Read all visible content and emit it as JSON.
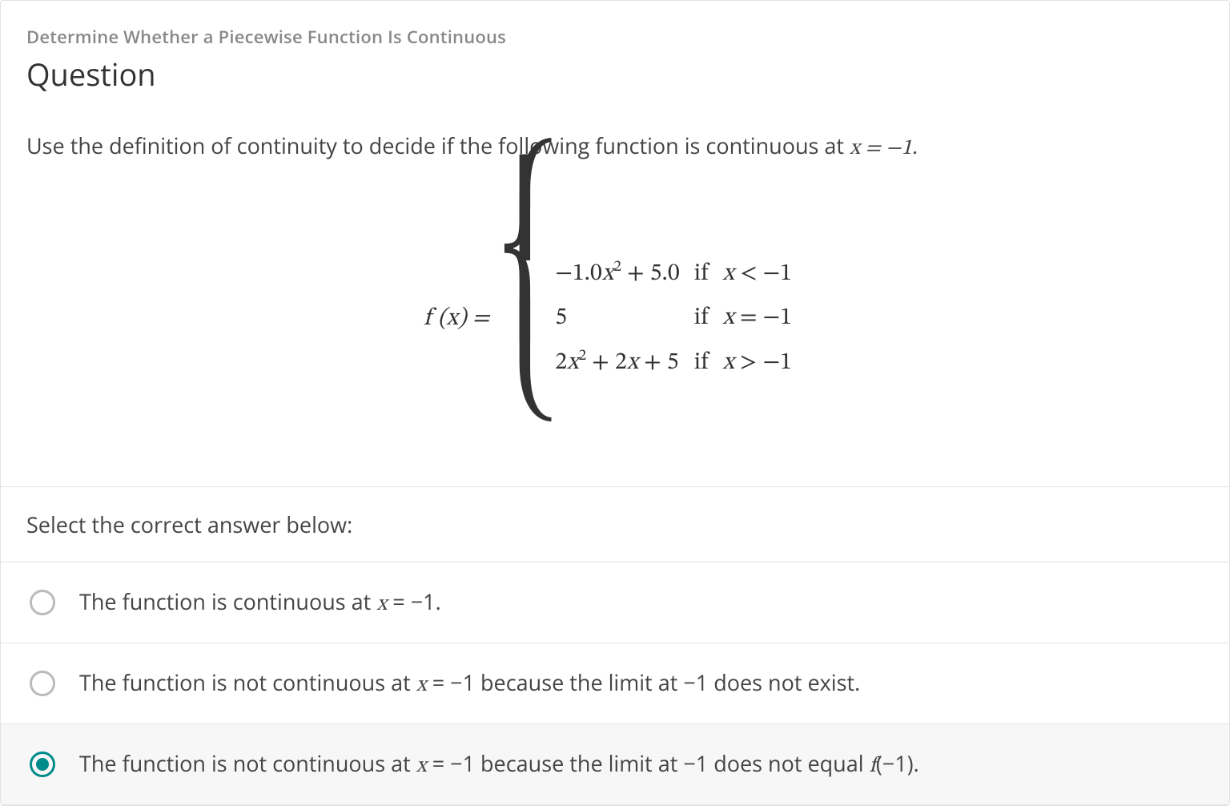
{
  "header": {
    "topic": "Determine Whether a Piecewise Function Is Continuous",
    "title": "Question"
  },
  "prompt": {
    "prefix": "Use the definition of continuity to decide if the following function is continuous at ",
    "math_tail": "x = −1.",
    "period": ""
  },
  "piecewise": {
    "lhs": "f (x) = ",
    "rows": [
      {
        "expr_html": "−1.0<span class='math-inline'>x</span><sup>2</sup> + 5.0",
        "cond_html": "<span class='math-inline'>x</span> < −1"
      },
      {
        "expr_html": "5",
        "cond_html": "<span class='math-inline'>x</span> = −1"
      },
      {
        "expr_html": "2<span class='math-inline'>x</span><sup>2</sup> + 2<span class='math-inline'>x</span> + 5",
        "cond_html": "<span class='math-inline'>x</span> > −1"
      }
    ],
    "if_word": "if"
  },
  "select_label": "Select the correct answer below:",
  "answers": [
    {
      "selected": false,
      "html": "The function is continuous at <span class='math-inline'>x</span> = −1."
    },
    {
      "selected": false,
      "html": "The function is not continuous at <span class='math-inline'>x</span> = −1 because the limit at −1 does not exist."
    },
    {
      "selected": true,
      "html": "The function is not continuous at <span class='math-inline'>x</span> = −1 because the limit at −1 does not equal <span class='math-inline'>f</span>(−1)."
    }
  ]
}
